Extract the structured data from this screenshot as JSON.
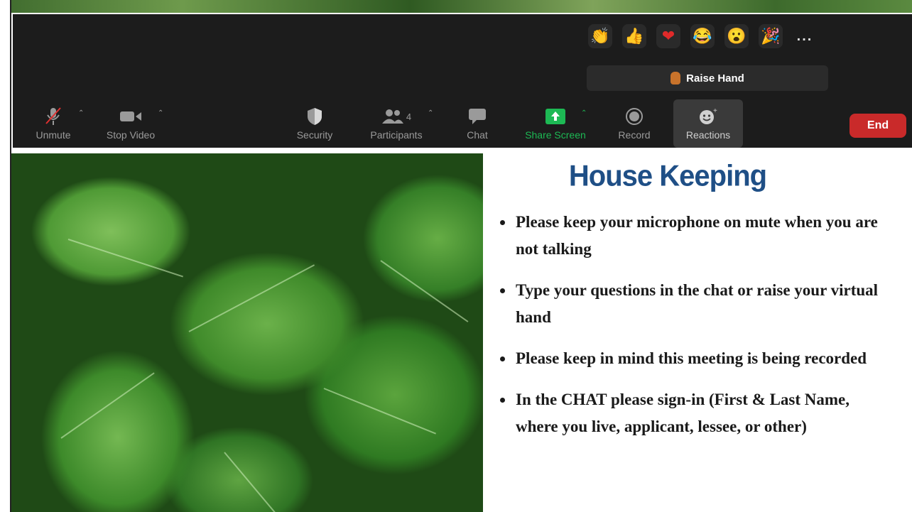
{
  "meeting_toolbar": {
    "reactions": [
      {
        "icon": "clapping-hands-icon",
        "glyph": "👏",
        "bg": "#b07a3a"
      },
      {
        "icon": "thumbs-up-icon",
        "glyph": "👍",
        "bg": "#c48a40"
      },
      {
        "icon": "heart-icon",
        "glyph": "❤",
        "bg": "#d22a2a"
      },
      {
        "icon": "laughing-face-icon",
        "glyph": "😂",
        "bg": "#e7b12c"
      },
      {
        "icon": "surprised-face-icon",
        "glyph": "😮",
        "bg": "#e9a12a"
      },
      {
        "icon": "party-popper-icon",
        "glyph": "🎉",
        "bg": "#b5893a"
      }
    ],
    "more_label": "...",
    "raise_hand_label": "Raise Hand",
    "unmute_label": "Unmute",
    "stop_video_label": "Stop Video",
    "security_label": "Security",
    "participants_label": "Participants",
    "participants_count": "4",
    "chat_label": "Chat",
    "share_screen_label": "Share Screen",
    "record_label": "Record",
    "reactions_label": "Reactions",
    "end_label": "End",
    "share_color": "#1db954",
    "end_color": "#c92a2a"
  },
  "slide": {
    "title": "House Keeping",
    "bullets": [
      "Please keep your microphone on mute when you are not talking",
      "Type your questions in the chat or raise your virtual hand",
      "Please keep in mind this meeting is being recorded",
      "In the CHAT please sign-in (First & Last Name, where you live, applicant, lessee, or other)"
    ],
    "title_color": "#1f4f86"
  }
}
